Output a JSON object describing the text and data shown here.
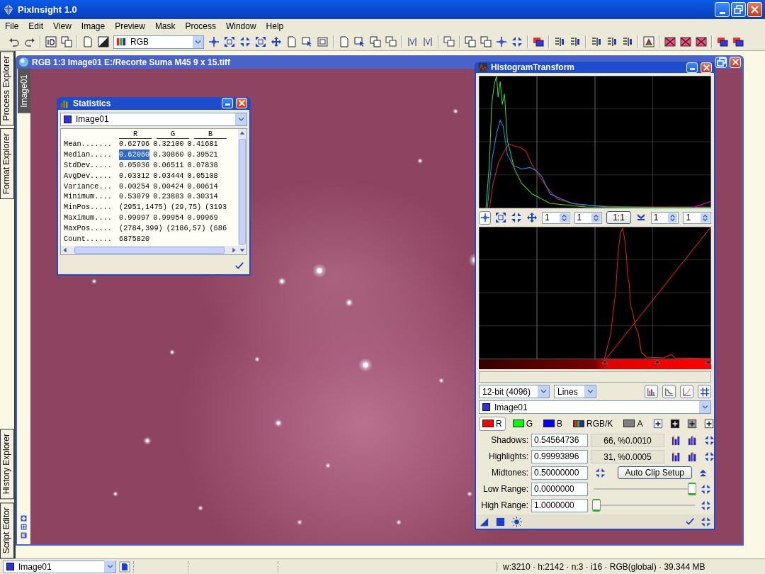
{
  "window": {
    "title": "PixInsight 1.0"
  },
  "menu": [
    "File",
    "Edit",
    "View",
    "Image",
    "Preview",
    "Mask",
    "Process",
    "Window",
    "Help"
  ],
  "toolbar": {
    "color_mode": "RGB"
  },
  "side_tabs_top": [
    {
      "label": "Process Explorer"
    },
    {
      "label": "Format Explorer"
    }
  ],
  "side_tabs_bottom": [
    {
      "label": "History Explorer"
    },
    {
      "label": "Script Editor"
    }
  ],
  "image_window": {
    "title": "RGB 1:3 Image01 E:/Recorte Suma M45 9 x 15.tiff",
    "tab": "Image01"
  },
  "statistics": {
    "title": "Statistics",
    "image": "Image01",
    "columns": [
      "R",
      "G",
      "B"
    ],
    "rows": [
      {
        "label": "Mean.......",
        "values": [
          {
            "text": "0.62796",
            "selected": false
          },
          {
            "text": "0.32100",
            "selected": false
          },
          {
            "text": "0.41681",
            "selected": false
          }
        ]
      },
      {
        "label": "Median.....",
        "values": [
          {
            "text": "0.62060",
            "selected": true
          },
          {
            "text": "0.30860",
            "selected": false
          },
          {
            "text": "0.39521",
            "selected": false
          }
        ]
      },
      {
        "label": "StdDev.....",
        "values": [
          {
            "text": "0.05036",
            "selected": false
          },
          {
            "text": "0.06511",
            "selected": false
          },
          {
            "text": "0.07838",
            "selected": false
          }
        ]
      },
      {
        "label": "AvgDev.....",
        "values": [
          {
            "text": "0.03312",
            "selected": false
          },
          {
            "text": "0.03444",
            "selected": false
          },
          {
            "text": "0.05108",
            "selected": false
          }
        ]
      },
      {
        "label": "Variance...",
        "values": [
          {
            "text": "0.00254",
            "selected": false
          },
          {
            "text": "0.00424",
            "selected": false
          },
          {
            "text": "0.00614",
            "selected": false
          }
        ]
      },
      {
        "label": "Minimum....",
        "values": [
          {
            "text": "0.53079",
            "selected": false
          },
          {
            "text": "0.23883",
            "selected": false
          },
          {
            "text": "0.30314",
            "selected": false
          }
        ]
      },
      {
        "label": "MinPos.....",
        "values": [
          {
            "text": "(2951,1475)",
            "selected": false
          },
          {
            "text": "(29,75)",
            "selected": false
          },
          {
            "text": "(3193",
            "selected": false
          }
        ]
      },
      {
        "label": "Maximum....",
        "values": [
          {
            "text": "0.99997",
            "selected": false
          },
          {
            "text": "0.99954",
            "selected": false
          },
          {
            "text": "0.99969",
            "selected": false
          }
        ]
      },
      {
        "label": "MaxPos.....",
        "values": [
          {
            "text": "(2784,399)",
            "selected": false
          },
          {
            "text": "(2186,57)",
            "selected": false
          },
          {
            "text": "(686",
            "selected": false
          }
        ]
      },
      {
        "label": "Count......",
        "values": [
          {
            "text": "6875820",
            "selected": false
          }
        ]
      }
    ]
  },
  "histogram": {
    "title": "HistogramTransform",
    "zoom_fields": [
      "1",
      "1"
    ],
    "zoom_button": "1:1",
    "range_fields": [
      "1",
      "1"
    ],
    "resolution": "12-bit (4096)",
    "graph_style": "Lines",
    "image": "Image01",
    "channels": [
      {
        "label": "R",
        "kind": "swatch",
        "color": "#ff0000",
        "selected": true
      },
      {
        "label": "G",
        "kind": "swatch",
        "color": "#00ff00",
        "selected": false
      },
      {
        "label": "B",
        "kind": "swatch",
        "color": "#0000ff",
        "selected": false
      },
      {
        "label": "RGB/K",
        "kind": "spectrum",
        "selected": false
      },
      {
        "label": "A",
        "kind": "swatch",
        "color": "#808080",
        "selected": false
      }
    ],
    "shadows": {
      "label": "Shadows:",
      "value": "0.54564736",
      "clipped": "66, %0.0010"
    },
    "highlights": {
      "label": "Highlights:",
      "value": "0.99993896",
      "clipped": "31, %0.0005"
    },
    "midtones": {
      "label": "Midtones:",
      "value": "0.50000000"
    },
    "auto_clip": "Auto Clip Setup",
    "low_range": {
      "label": "Low Range:",
      "value": "0.0000000",
      "level": 1
    },
    "high_range": {
      "label": "High Range:",
      "value": "1.0000000",
      "level": 0
    }
  },
  "status_bar": {
    "image": "Image01",
    "info": "w:3210 · h:2142 · n:3 · i16 · RGB(global) · 39.344 MB"
  }
}
